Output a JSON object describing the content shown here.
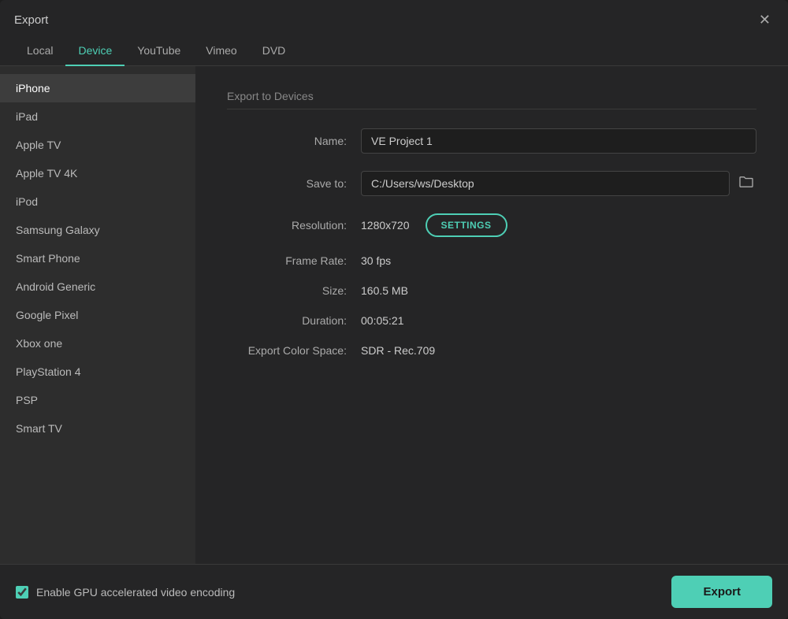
{
  "window": {
    "title": "Export"
  },
  "tabs": [
    {
      "id": "local",
      "label": "Local",
      "active": false
    },
    {
      "id": "device",
      "label": "Device",
      "active": true
    },
    {
      "id": "youtube",
      "label": "YouTube",
      "active": false
    },
    {
      "id": "vimeo",
      "label": "Vimeo",
      "active": false
    },
    {
      "id": "dvd",
      "label": "DVD",
      "active": false
    }
  ],
  "sidebar": {
    "items": [
      {
        "id": "iphone",
        "label": "iPhone",
        "selected": true
      },
      {
        "id": "ipad",
        "label": "iPad",
        "selected": false
      },
      {
        "id": "apple-tv",
        "label": "Apple TV",
        "selected": false
      },
      {
        "id": "apple-tv-4k",
        "label": "Apple TV 4K",
        "selected": false
      },
      {
        "id": "ipod",
        "label": "iPod",
        "selected": false
      },
      {
        "id": "samsung-galaxy",
        "label": "Samsung Galaxy",
        "selected": false
      },
      {
        "id": "smart-phone",
        "label": "Smart Phone",
        "selected": false
      },
      {
        "id": "android-generic",
        "label": "Android Generic",
        "selected": false
      },
      {
        "id": "google-pixel",
        "label": "Google Pixel",
        "selected": false
      },
      {
        "id": "xbox-one",
        "label": "Xbox one",
        "selected": false
      },
      {
        "id": "playstation-4",
        "label": "PlayStation 4",
        "selected": false
      },
      {
        "id": "psp",
        "label": "PSP",
        "selected": false
      },
      {
        "id": "smart-tv",
        "label": "Smart TV",
        "selected": false
      }
    ]
  },
  "content": {
    "section_title": "Export to Devices",
    "name_label": "Name:",
    "name_value": "VE Project 1",
    "save_to_label": "Save to:",
    "save_to_value": "C:/Users/ws/Desktop",
    "resolution_label": "Resolution:",
    "resolution_value": "1280x720",
    "settings_button": "SETTINGS",
    "frame_rate_label": "Frame Rate:",
    "frame_rate_value": "30 fps",
    "size_label": "Size:",
    "size_value": "160.5 MB",
    "duration_label": "Duration:",
    "duration_value": "00:05:21",
    "export_color_label": "Export Color Space:",
    "export_color_value": "SDR - Rec.709"
  },
  "footer": {
    "gpu_label": "Enable GPU accelerated video encoding",
    "gpu_checked": true,
    "export_button": "Export"
  },
  "icons": {
    "close": "✕",
    "folder": "🗁"
  }
}
